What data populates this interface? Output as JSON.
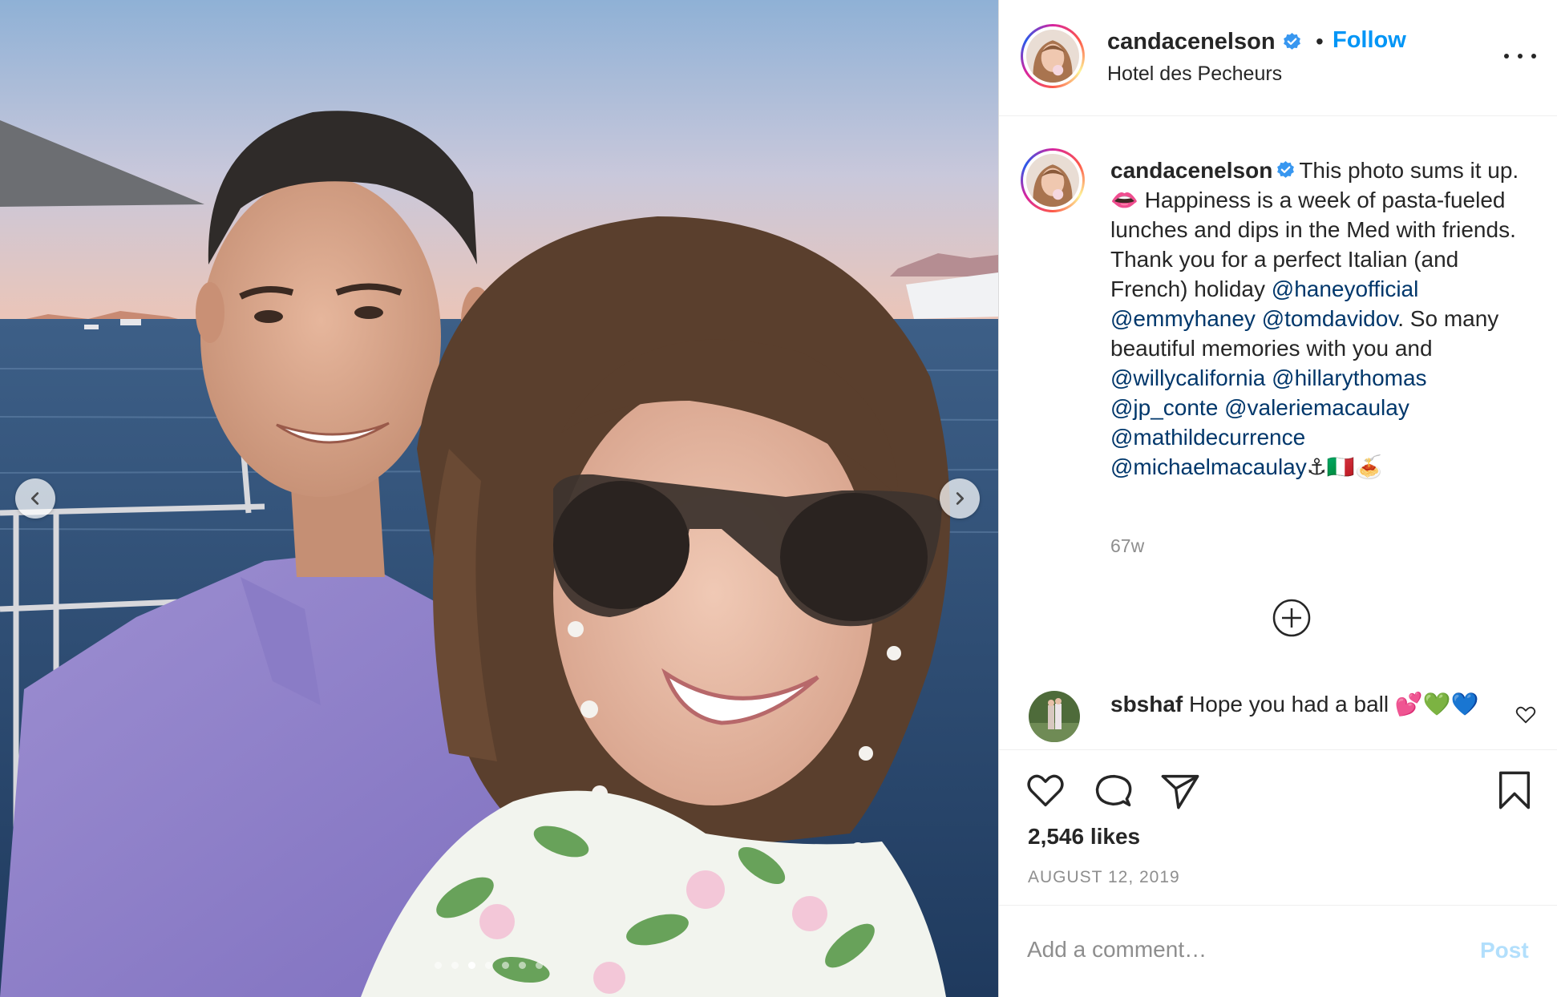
{
  "post": {
    "username": "candacenelson",
    "verified": true,
    "follow_label": "Follow",
    "separator": "•",
    "location": "Hotel des Pecheurs"
  },
  "caption": {
    "username": "candacenelson",
    "text_1": "This photo sums it up. ",
    "emoji_1": "👄",
    "text_2": " Happiness is a week of pasta-fueled lunches and dips in the Med with friends. Thank you for a perfect Italian (and French) holiday ",
    "mention_1": "@haneyofficial",
    "mention_2": "@emmyhaney",
    "mention_3": "@tomdavidov",
    "text_3": ". So many beautiful memories with you and ",
    "mention_4": "@willycalifornia",
    "mention_5": "@hillarythomas",
    "mention_6": "@jp_conte",
    "mention_7": "@valeriemacaulay",
    "mention_8": "@mathildecurrence",
    "mention_9": "@michaelmacaulay",
    "emoji_end": "⚓🇮🇹🍝",
    "time": "67w"
  },
  "comment": {
    "username": "sbshaf",
    "text": "Hope you had a ball 💕💚💙"
  },
  "actions": {
    "likes": "2,546 likes",
    "date": "AUGUST 12, 2019"
  },
  "add_comment": {
    "placeholder": "Add a comment…",
    "post_label": "Post"
  },
  "carousel": {
    "count": 7,
    "active_index": 2
  },
  "colors": {
    "link_blue": "#0095f6",
    "mention_blue": "#00376b",
    "muted": "#8e8e8e",
    "post_disabled": "#b2dffc",
    "verified_blue": "#3897f0"
  },
  "icons": {
    "prev": "chevron-left-icon",
    "next": "chevron-right-icon",
    "more": "more-options-icon",
    "verified": "verified-badge-icon",
    "load_more": "plus-circle-icon",
    "comment_like": "heart-icon",
    "like": "heart-icon",
    "comment": "comment-bubble-icon",
    "share": "paper-plane-icon",
    "save": "bookmark-icon"
  }
}
